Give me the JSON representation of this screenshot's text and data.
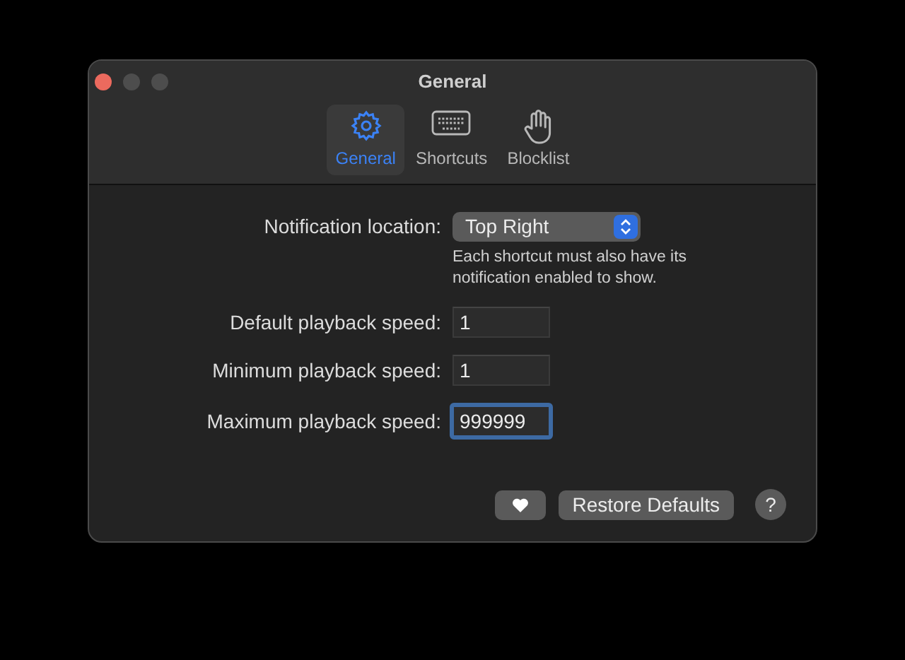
{
  "window": {
    "title": "General"
  },
  "tabs": [
    {
      "kind": "gear",
      "label": "General",
      "selected": true
    },
    {
      "kind": "keyboard",
      "label": "Shortcuts",
      "selected": false
    },
    {
      "kind": "hand",
      "label": "Blocklist",
      "selected": false
    }
  ],
  "notification": {
    "label": "Notification location:",
    "value": "Top Right",
    "hint": "Each shortcut must also have its notification enabled to show."
  },
  "fields": [
    {
      "label": "Default playback speed:",
      "value": "1",
      "focused": false
    },
    {
      "label": "Minimum playback speed:",
      "value": "1",
      "focused": false
    },
    {
      "label": "Maximum playback speed:",
      "value": "999999",
      "focused": true
    }
  ],
  "buttons": {
    "restore": "Restore Defaults",
    "help": "?"
  }
}
